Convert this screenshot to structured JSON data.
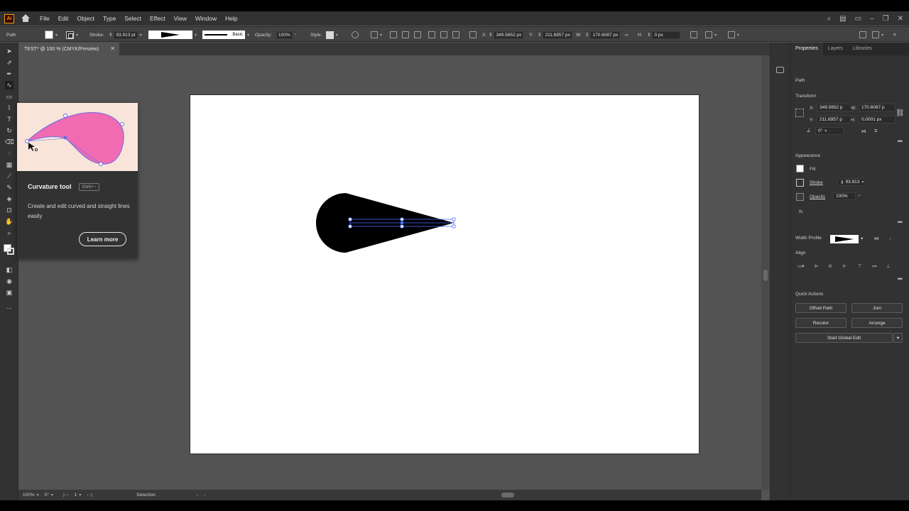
{
  "menubar": {
    "logo": "Ai",
    "items": [
      "File",
      "Edit",
      "Object",
      "Type",
      "Select",
      "Effect",
      "View",
      "Window",
      "Help"
    ]
  },
  "control": {
    "object_type": "Path",
    "stroke_label": "Stroke:",
    "stroke_value": "93.913 pt",
    "brush_label": "Basic",
    "opacity_label": "Opacity:",
    "opacity_value": "100%",
    "style_label": "Style:",
    "x_label": "X:",
    "x_value": "349.5652 px",
    "y_label": "Y:",
    "y_value": "211.6957 px",
    "w_label": "W:",
    "w_value": "170.6087 px",
    "h_label": "H:",
    "h_value": "0 px"
  },
  "doc_tab": {
    "title": "TEST* @ 100 % (CMYK/Preview)"
  },
  "tooltip": {
    "title": "Curvature tool",
    "shortcut": "Shift+~",
    "description": "Create and edit curved and straight lines easily",
    "button": "Learn more",
    "fill_color": "#f06bb1"
  },
  "status": {
    "zoom": "100%",
    "rotation": "0°",
    "artboard": "1",
    "tool": "Selection"
  },
  "properties": {
    "tabs": [
      "Properties",
      "Layers",
      "Libraries"
    ],
    "object": "Path",
    "transform_title": "Transform",
    "x_label": "X:",
    "x_value": "349.5652 p",
    "y_label": "Y:",
    "y_value": "211.6957 p",
    "w_label": "W:",
    "w_value": "170.6087 p",
    "h_label": "H:",
    "h_value": "0.0001 px",
    "angle_value": "0°",
    "appearance_title": "Appearance",
    "fill_label": "Fill",
    "stroke_label": "Stroke",
    "stroke_value": "93.913",
    "opacity_label": "Opacity",
    "opacity_value": "100%",
    "fx_label": "fx.",
    "width_profile_label": "Width Profile",
    "align_title": "Align",
    "quick_actions_title": "Quick Actions",
    "quick_actions": [
      "Offset Path",
      "Join",
      "Recolor",
      "Arrange",
      "Start Global Edit"
    ]
  },
  "colors": {
    "ui_dark": "#323232",
    "canvas": "#535353",
    "selection": "#4a6cff",
    "brand": "#ff9a00"
  }
}
